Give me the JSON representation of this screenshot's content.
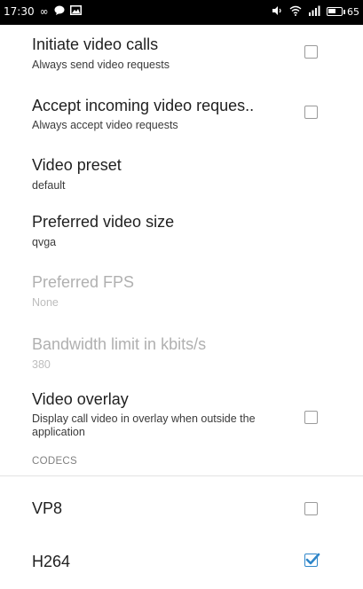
{
  "status_bar": {
    "time": "17:30",
    "battery_level": "65",
    "battery_fraction": 0.65,
    "icons": [
      "infinity-icon",
      "chat-bubble-icon",
      "image-icon",
      "volume-icon",
      "wifi-icon",
      "signal-icon",
      "battery-icon"
    ]
  },
  "settings": {
    "initiate_video_calls": {
      "title": "Initiate video calls",
      "summary": "Always send video requests",
      "checked": false
    },
    "accept_incoming_video": {
      "title": "Accept incoming video reques..",
      "summary": "Always accept video requests",
      "checked": false
    },
    "video_preset": {
      "title": "Video preset",
      "value": "default"
    },
    "preferred_video_size": {
      "title": "Preferred video size",
      "value": "qvga"
    },
    "preferred_fps": {
      "title": "Preferred FPS",
      "value": "None",
      "enabled": false
    },
    "bandwidth_limit": {
      "title": "Bandwidth limit in kbits/s",
      "value": "380",
      "enabled": false
    },
    "video_overlay": {
      "title": "Video overlay",
      "summary": "Display call video in overlay when outside the application",
      "checked": false
    },
    "codecs_header": "CODECS",
    "codecs": [
      {
        "name": "VP8",
        "checked": false
      },
      {
        "name": "H264",
        "checked": true
      }
    ]
  },
  "colors": {
    "accent": "#2f86c9",
    "status_bar": "#000000",
    "background": "#ffffff"
  }
}
